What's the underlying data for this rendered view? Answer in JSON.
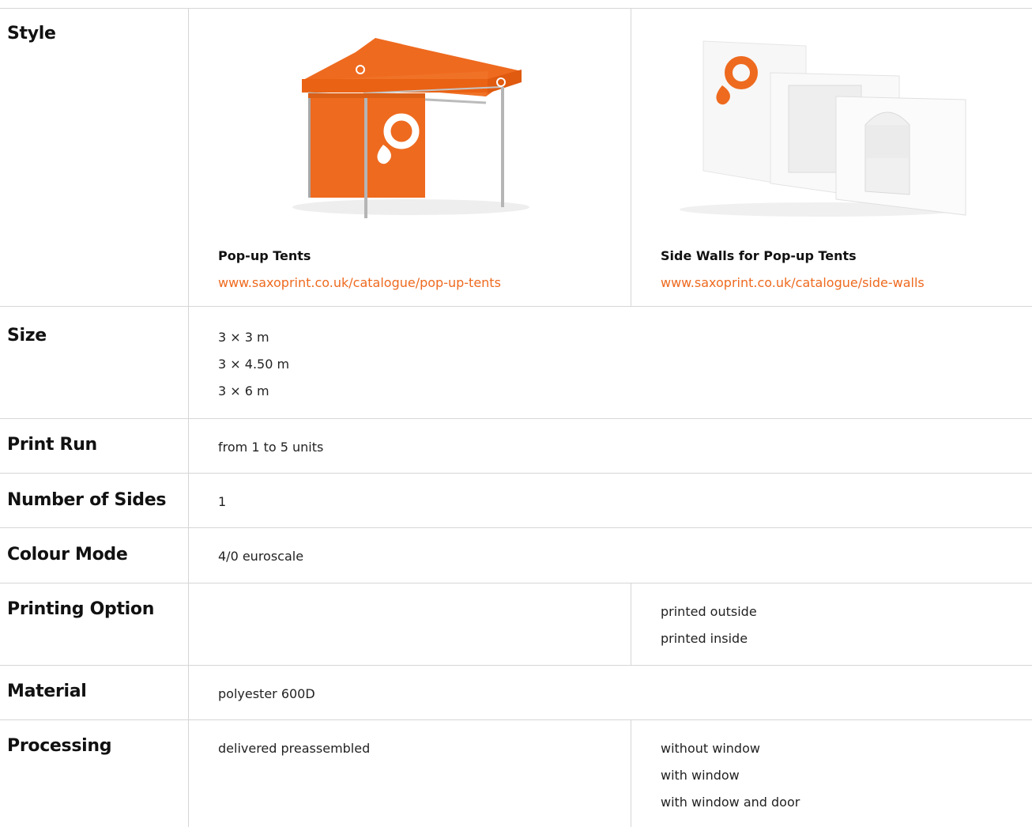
{
  "labels": {
    "style": "Style",
    "size": "Size",
    "print_run": "Print Run",
    "sides": "Number of Sides",
    "colour": "Colour Mode",
    "printing": "Printing Option",
    "material": "Material",
    "processing": "Processing"
  },
  "products": [
    {
      "title": "Pop-up Tents",
      "link": "www.saxoprint.co.uk/catalogue/pop-up-tents",
      "image": "orange-pop-up-tent"
    },
    {
      "title": "Side Walls for Pop-up Tents",
      "link": "www.saxoprint.co.uk/catalogue/side-walls",
      "image": "white-side-walls"
    }
  ],
  "size": [
    "3 × 3 m",
    "3 × 4.50 m",
    "3 × 6 m"
  ],
  "print_run": "from 1 to 5 units",
  "sides": "1",
  "colour_mode": "4/0 euroscale",
  "printing_options": [
    "printed outside",
    "printed inside"
  ],
  "material": "polyester 600D",
  "processing": {
    "tents": "delivered preassembled",
    "walls": [
      "without window",
      "with window",
      "with window and door"
    ]
  },
  "colors": {
    "accent": "#ee6a1f",
    "divider": "#d6d6d6"
  }
}
